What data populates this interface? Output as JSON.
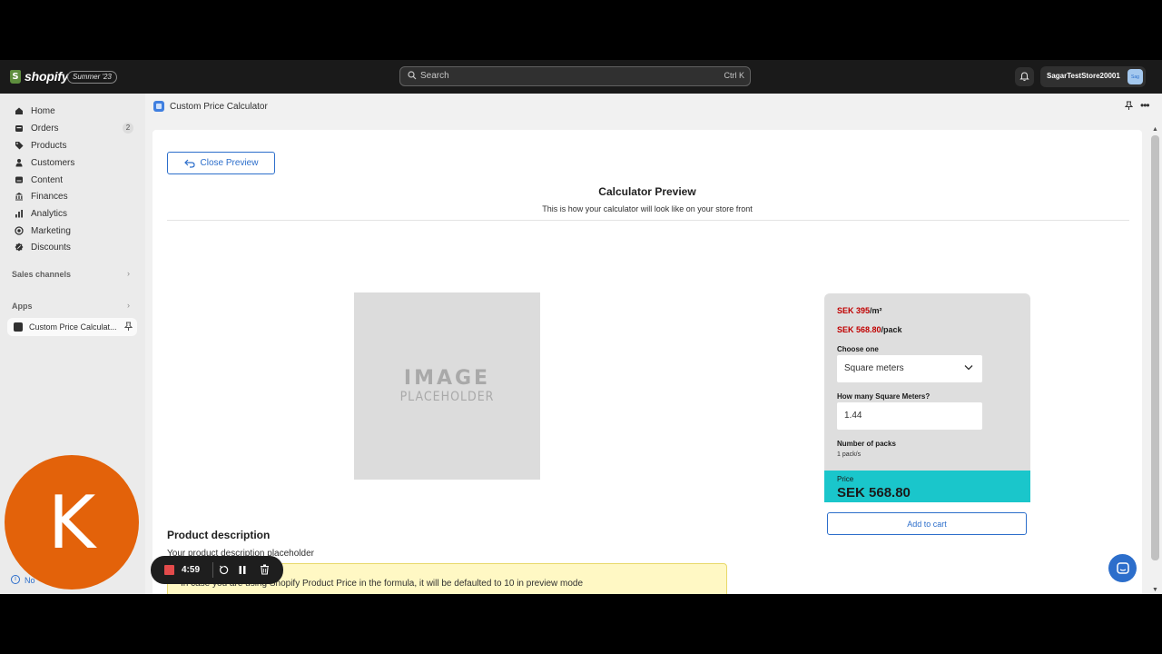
{
  "topbar": {
    "brand": "shopify",
    "edition_badge": "Summer '23",
    "search_placeholder": "Search",
    "search_shortcut": "Ctrl K",
    "store_name": "SagarTestStore20001",
    "store_avatar": "Sag"
  },
  "sidebar": {
    "items": [
      {
        "label": "Home",
        "icon": "home-icon"
      },
      {
        "label": "Orders",
        "icon": "orders-icon",
        "count": "2"
      },
      {
        "label": "Products",
        "icon": "tag-icon"
      },
      {
        "label": "Customers",
        "icon": "person-icon"
      },
      {
        "label": "Content",
        "icon": "content-icon"
      },
      {
        "label": "Finances",
        "icon": "bank-icon"
      },
      {
        "label": "Analytics",
        "icon": "bar-chart-icon"
      },
      {
        "label": "Marketing",
        "icon": "target-icon"
      },
      {
        "label": "Discounts",
        "icon": "discount-icon"
      }
    ],
    "sales_channels": "Sales channels",
    "apps": "Apps",
    "app_item": "Custom Price Calculat...",
    "notice": "No"
  },
  "page": {
    "title": "Custom Price Calculator"
  },
  "preview": {
    "close_label": "Close Preview",
    "title": "Calculator Preview",
    "subtitle": "This is how your calculator will look like on your store front",
    "image_line1": "IMAGE",
    "image_line2": "PLACEHOLDER"
  },
  "calculator": {
    "price_per_unit_amount": "SEK 395",
    "price_per_unit_unit": "/m²",
    "price_per_pack_amount": "SEK 568.80",
    "price_per_pack_unit": "/pack",
    "choose_label": "Choose one",
    "choose_value": "Square meters",
    "qty_label": "How many Square Meters?",
    "qty_value": "1.44",
    "packs_label": "Number of packs",
    "packs_value": "1 pack/s",
    "price_label": "Price",
    "price_value": "SEK 568.80",
    "add_to_cart": "Add to cart"
  },
  "description": {
    "title": "Product description",
    "text": "Your product description placeholder",
    "banner": "In case you are using Shopify Product Price in the formula, it will be defaulted to 10 in preview mode"
  },
  "overlay": {
    "avatar_letter": "K",
    "recording_time": "4:59"
  },
  "colors": {
    "accent": "#2c6ecb",
    "price_bar": "#1ac6cb",
    "price_red": "#c00000",
    "avatar": "#e3620a"
  }
}
